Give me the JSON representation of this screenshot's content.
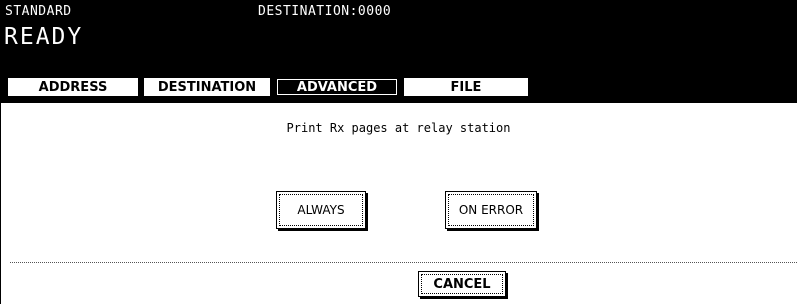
{
  "header": {
    "mode": "STANDARD",
    "destination_label": "DESTINATION:",
    "destination_count": "0000",
    "status": "READY"
  },
  "tabs": [
    {
      "label": "ADDRESS",
      "active": false
    },
    {
      "label": "DESTINATION",
      "active": false
    },
    {
      "label": "ADVANCED",
      "active": true
    },
    {
      "label": "FILE",
      "active": false
    }
  ],
  "content": {
    "prompt": "Print Rx pages at relay station",
    "option_always": "ALWAYS",
    "option_on_error": "ON ERROR"
  },
  "footer": {
    "cancel_label": "CANCEL"
  },
  "colors": {
    "header_bg": "#000000",
    "header_text": "#ffffff",
    "body_bg": "#ffffff"
  }
}
